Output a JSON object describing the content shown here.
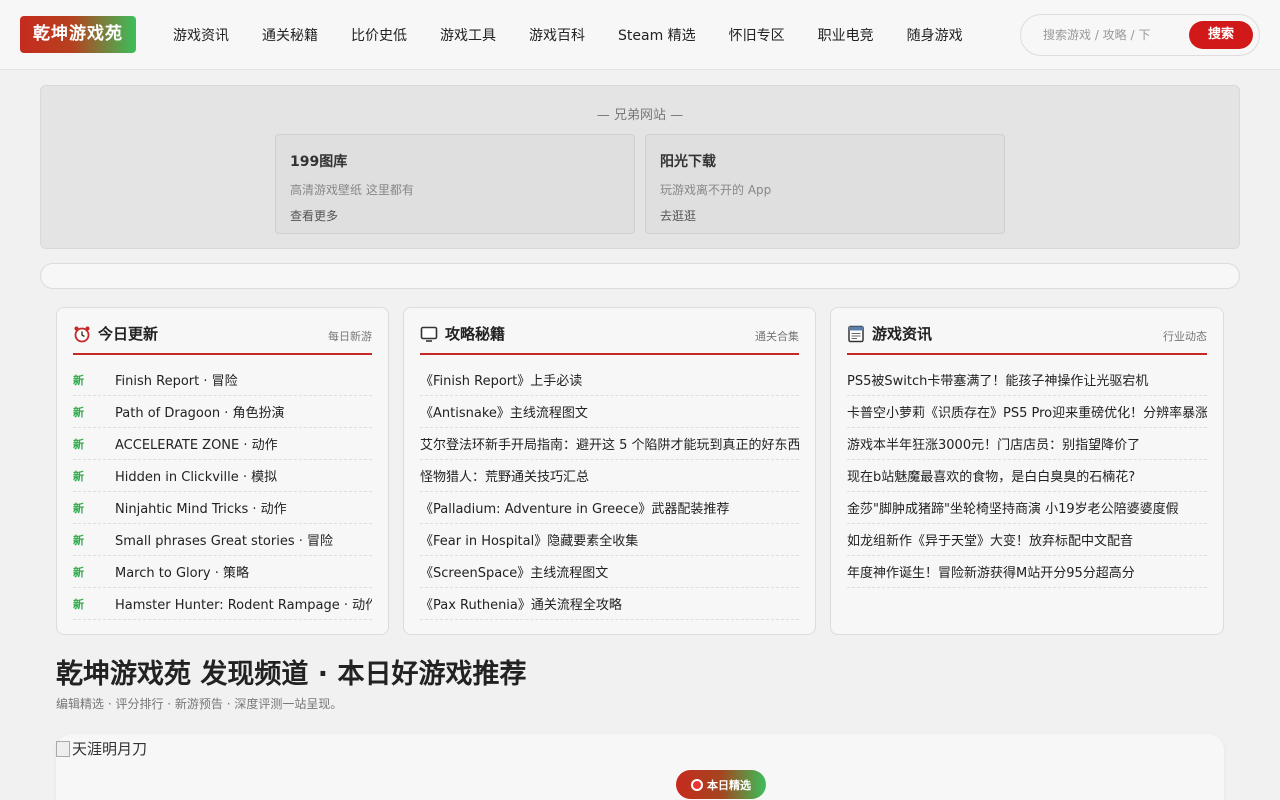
{
  "header": {
    "logo": "乾坤游戏苑",
    "nav": [
      "游戏资讯",
      "通关秘籍",
      "比价史低",
      "游戏工具",
      "游戏百科",
      "Steam 精选",
      "怀旧专区",
      "职业电竞",
      "随身游戏"
    ],
    "search": {
      "placeholder": "搜索游戏 / 攻略 / 下",
      "button": "搜索"
    }
  },
  "sister_sites": {
    "title": "— 兄弟网站 —",
    "sites": [
      {
        "name": "199图库",
        "desc": "高清游戏壁纸 这里都有",
        "link": "查看更多"
      },
      {
        "name": "阳光下载",
        "desc": "玩游戏离不开的 App",
        "link": "去逛逛"
      }
    ]
  },
  "cards": [
    {
      "title": "今日更新",
      "subtitle": "每日新游",
      "icon": "alarm-clock-icon",
      "tag": "新",
      "items": [
        "Finish Report · 冒险",
        "Path of Dragoon · 角色扮演",
        "ACCELERATE ZONE · 动作",
        "Hidden in Clickville · 模拟",
        "Ninjahtic Mind Tricks · 动作",
        "Small phrases Great stories · 冒险",
        "March to Glory · 策略",
        "Hamster Hunter: Rodent Rampage · 动作"
      ]
    },
    {
      "title": "攻略秘籍",
      "subtitle": "通关合集",
      "icon": "monitor-icon",
      "items": [
        "《Finish Report》上手必读",
        "《Antisnake》主线流程图文",
        "艾尔登法环新手开局指南：避开这 5 个陷阱才能玩到真正的好东西",
        "怪物猎人：荒野通关技巧汇总",
        "《Palladium: Adventure in Greece》武器配装推荐",
        "《Fear in Hospital》隐藏要素全收集",
        "《ScreenSpace》主线流程图文",
        "《Pax Ruthenia》通关流程全攻略"
      ]
    },
    {
      "title": "游戏资讯",
      "subtitle": "行业动态",
      "icon": "newspaper-icon",
      "items": [
        "PS5被Switch卡带塞满了！能孩子神操作让光驱宕机",
        "卡普空小萝莉《识质存在》PS5 Pro迎来重磅优化！分辨率暴涨",
        "游戏本半年狂涨3000元！门店店员：别指望降价了",
        "现在b站魅魔最喜欢的食物，是白白臭臭的石楠花?",
        "金莎\"脚肿成猪蹄\"坐轮椅坚持商演 小19岁老公陪婆婆度假",
        "如龙组新作《异于天堂》大变！放弃标配中文配音",
        "年度神作诞生！冒险新游获得M站开分95分超高分"
      ]
    }
  ],
  "discover": {
    "title": "乾坤游戏苑 发现频道 · 本日好游戏推荐",
    "subtitle": "编辑精选 · 评分排行 · 新游预告 · 深度评测一站呈现。",
    "feature_img_alt": "天涯明月刀",
    "badge": "本日精选"
  }
}
